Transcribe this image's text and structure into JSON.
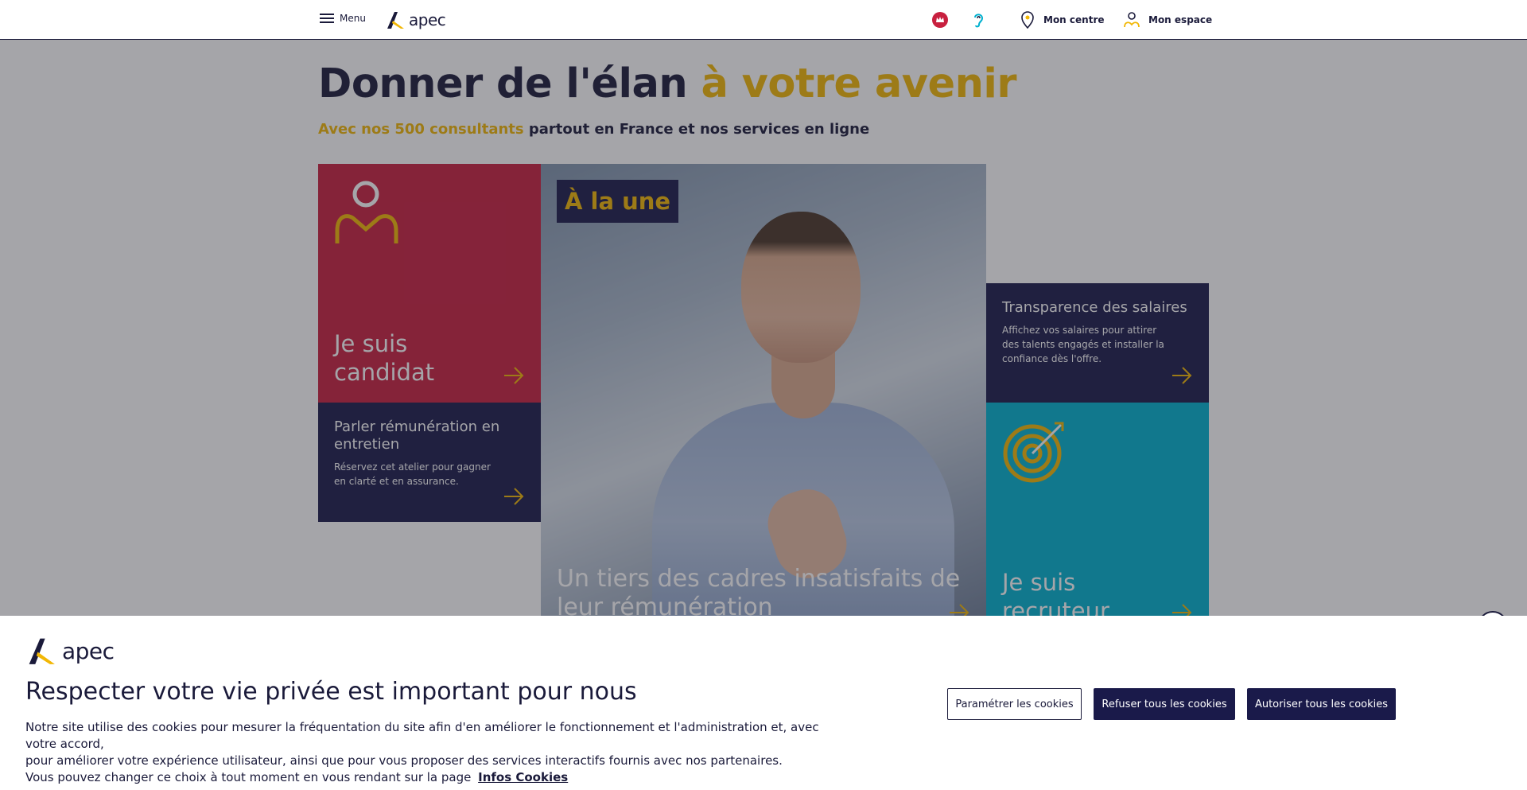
{
  "header": {
    "menu_label": "Menu",
    "logo_text": "apec",
    "links": {
      "mon_centre": "Mon centre",
      "mon_espace": "Mon espace"
    }
  },
  "hero": {
    "title_main": "Donner de l'élan",
    "title_accent": "à votre avenir",
    "subtitle_accent": "Avec nos 500 consultants",
    "subtitle_rest": "partout en France et nos services en ligne"
  },
  "tiles": {
    "candidat": {
      "line1": "Je suis",
      "line2": "candidat"
    },
    "remuneration": {
      "title_line1": "Parler rémunération en",
      "title_line2": "entretien",
      "desc_line1": "Réservez cet atelier pour gagner",
      "desc_line2": "en clarté et en assurance."
    },
    "une": {
      "badge": "À la une",
      "line1": "Un tiers des cadres insatisfaits de",
      "line2": "leur rémunération"
    },
    "transparence": {
      "title": "Transparence des salaires",
      "desc_line1": "Affichez vos salaires pour attirer",
      "desc_line2": "des talents engagés et installer la",
      "desc_line3": "confiance dès l'offre."
    },
    "recruteur": {
      "line1": "Je suis",
      "line2": "recruteur"
    }
  },
  "cookie": {
    "logo_text": "apec",
    "title": "Respecter votre vie privée est important pour nous",
    "text_line1": "Notre site utilise des cookies pour mesurer la fréquentation du site afin d'en améliorer le fonctionnement et l'administration et, avec votre accord,",
    "text_line2": "pour améliorer votre expérience utilisateur, ainsi que pour vous proposer des services interactifs fournis avec nos partenaires.",
    "text_line3": "Vous pouvez changer ce choix à tout moment en vous rendant sur la page",
    "link": "Infos Cookies",
    "btn_settings": "Paramétrer les cookies",
    "btn_refuse": "Refuser tous les cookies",
    "btn_accept": "Autoriser tous les cookies"
  },
  "colors": {
    "navy": "#1a1a4a",
    "yellow": "#f2b705",
    "red": "#c8203f",
    "cyan": "#00b1cf"
  }
}
